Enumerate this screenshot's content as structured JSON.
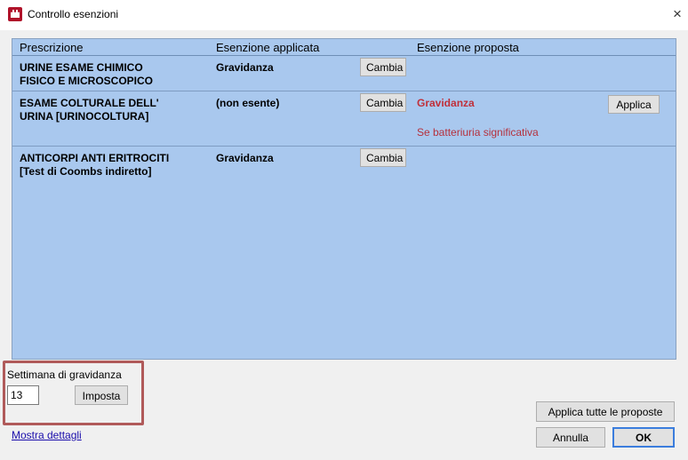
{
  "window": {
    "title": "Controllo esenzioni",
    "close_glyph": "×"
  },
  "columns": {
    "prescription": "Prescrizione",
    "applied": "Esenzione applicata",
    "proposed": "Esenzione proposta"
  },
  "rows": [
    {
      "prescription": "URINE ESAME CHIMICO\nFISICO E MICROSCOPICO",
      "applied": "Gravidanza",
      "change_label": "Cambia",
      "proposed": "",
      "note": "",
      "apply_label": ""
    },
    {
      "prescription": "ESAME COLTURALE DELL'\nURINA [URINOCOLTURA]",
      "applied": "(non esente)",
      "change_label": "Cambia",
      "proposed": "Gravidanza",
      "note": "Se batteriuria significativa",
      "apply_label": "Applica"
    },
    {
      "prescription": "ANTICORPI ANTI ERITROCITI\n[Test di Coombs indiretto]",
      "applied": "Gravidanza",
      "change_label": "Cambia",
      "proposed": "",
      "note": "",
      "apply_label": ""
    }
  ],
  "pregnancy_week": {
    "label": "Settimana di gravidanza",
    "value": "13",
    "set_label": "Imposta"
  },
  "footer": {
    "details_link": "Mostra dettagli",
    "apply_all_label": "Applica tutte le proposte",
    "cancel_label": "Annulla",
    "ok_label": "OK"
  },
  "colors": {
    "panel_bg": "#a9c8ee",
    "proposed_text": "#c0303a",
    "highlight_box": "#b05a5a",
    "ok_border": "#3b7ddd"
  },
  "icons": {
    "app_icon": "castle-app-icon",
    "close": "close-icon"
  }
}
